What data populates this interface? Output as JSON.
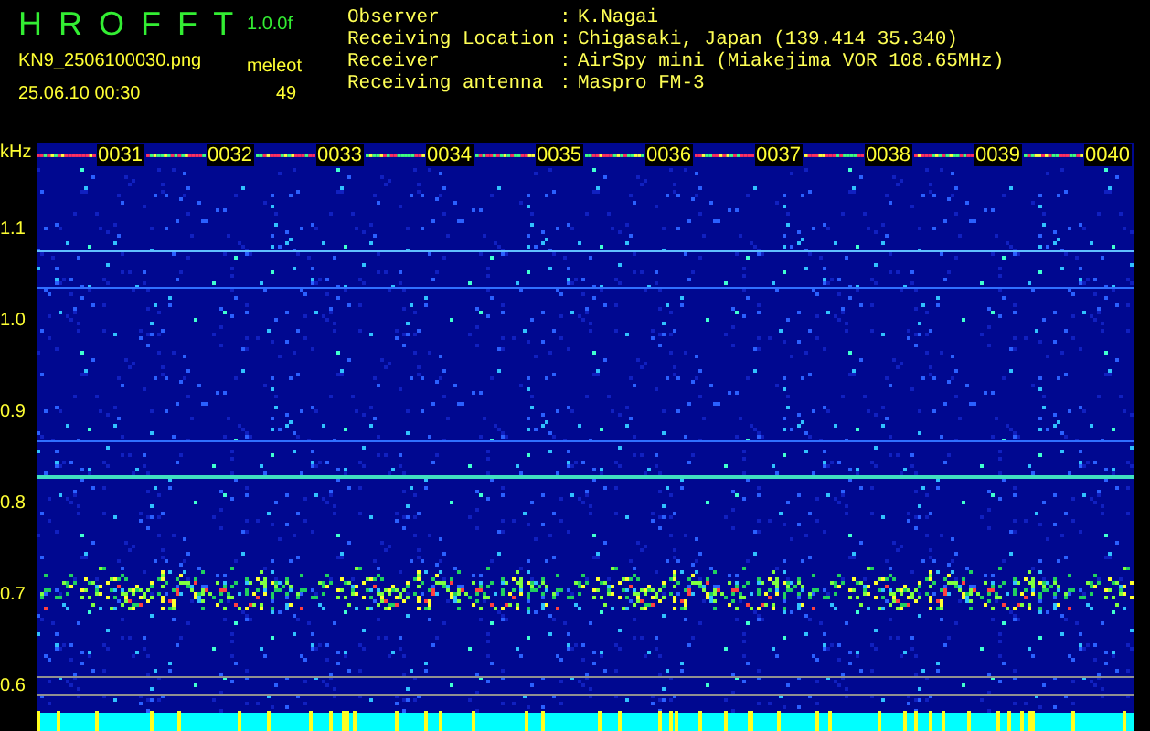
{
  "header": {
    "title": "H R O F F T",
    "version": "1.0.0f",
    "file": "KN9_2506100030.png",
    "category": "meleot",
    "count": "49",
    "timestamp": "25.06.10 00:30"
  },
  "info": [
    {
      "label": "Observer",
      "separator": ":",
      "value": "K.Nagai"
    },
    {
      "label": "Receiving Location",
      "separator": ":",
      "value": "Chigasaki, Japan (139.414 35.340)"
    },
    {
      "label": "Receiver",
      "separator": ":",
      "value": "AirSpy mini (Miakejima VOR 108.65MHz)"
    },
    {
      "label": "Receiving antenna",
      "separator": ":",
      "value": "Maspro FM-3"
    }
  ],
  "spectrogram": {
    "unit": "kHz",
    "freq_labels": [
      "1.1",
      "1.0",
      "0.9",
      "0.8",
      "0.7",
      "0.6"
    ],
    "time_labels": [
      "0031",
      "0032",
      "0033",
      "0034",
      "0035",
      "0036",
      "0037",
      "0038",
      "0039",
      "0040"
    ]
  }
}
